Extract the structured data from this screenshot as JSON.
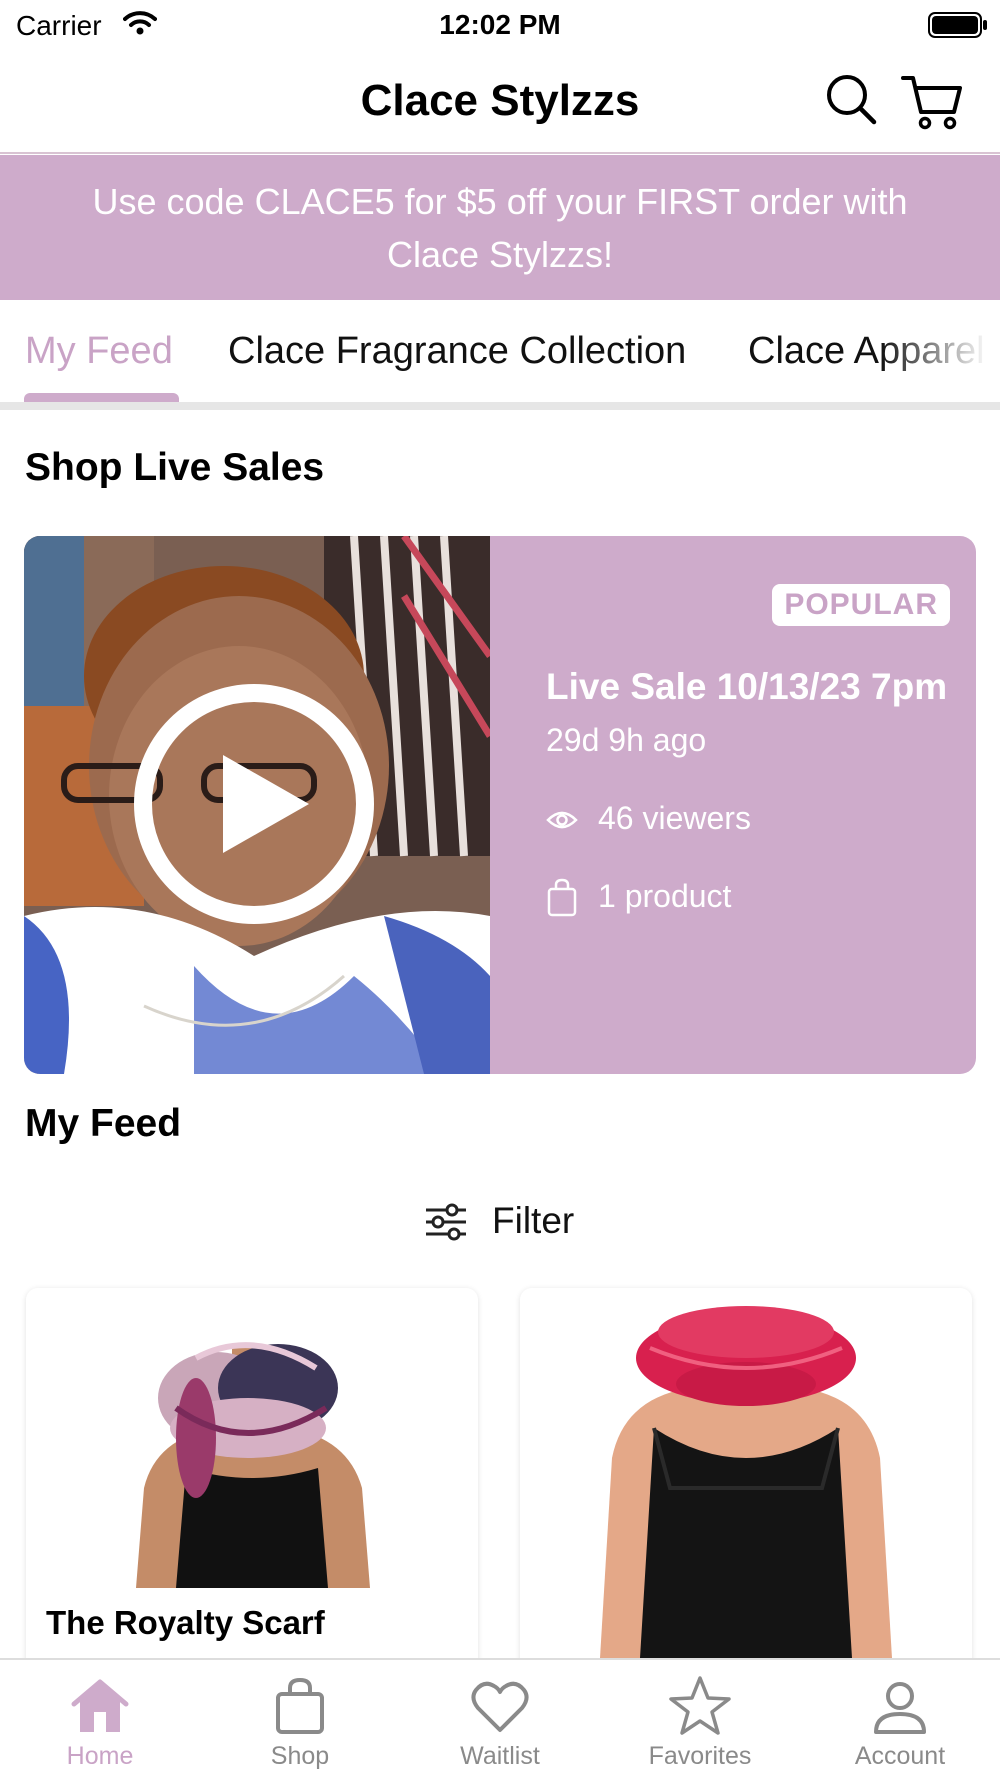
{
  "status_bar": {
    "carrier": "Carrier",
    "time": "12:02 PM"
  },
  "header": {
    "title": "Clace Stylzzs",
    "icons": [
      "search-icon",
      "cart-icon"
    ]
  },
  "promo_banner": {
    "line1": "Use code CLACE5 for $5 off your FIRST order with",
    "line2": "Clace Stylzzs!"
  },
  "tabs": [
    {
      "label": "My Feed",
      "active": true
    },
    {
      "label": "Clace Fragrance Collection",
      "active": false
    },
    {
      "label": "Clace Apparel",
      "active": false
    }
  ],
  "live_section": {
    "title": "Shop Live Sales",
    "card": {
      "badge": "POPULAR",
      "title": "Live Sale 10/13/23 7pm",
      "time_ago": "29d 9h ago",
      "viewers": "46 viewers",
      "products": "1 product"
    }
  },
  "feed_section": {
    "title": "My Feed",
    "filter_label": "Filter",
    "products": [
      {
        "name": "The Royalty Scarf",
        "image": "pink-purple-scarf-on-mannequin"
      },
      {
        "name": "",
        "image": "pink-knit-infinity-scarf-on-mannequin"
      }
    ]
  },
  "bottom_nav": [
    {
      "label": "Home",
      "icon": "home-icon",
      "active": true
    },
    {
      "label": "Shop",
      "icon": "shopping-bag-icon",
      "active": false
    },
    {
      "label": "Waitlist",
      "icon": "heart-icon",
      "active": false
    },
    {
      "label": "Favorites",
      "icon": "star-icon",
      "active": false
    },
    {
      "label": "Account",
      "icon": "user-icon",
      "active": false
    }
  ],
  "colors": {
    "accent": "#ceabcb",
    "accent_text": "#c9a3c6",
    "nav_inactive": "#8a8a8a"
  }
}
